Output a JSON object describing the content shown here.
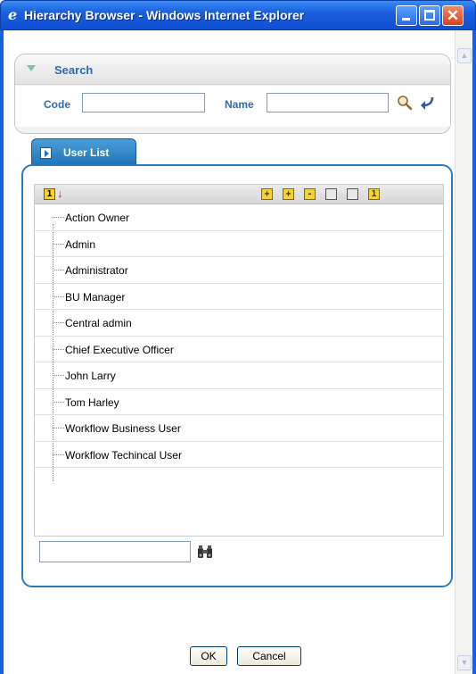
{
  "window": {
    "title": "Hierarchy Browser - Windows Internet Explorer",
    "title_color": "#ffffff",
    "titlebar_color": "#1a5fe0",
    "buttons": {
      "minimize": "minimize-icon",
      "maximize": "maximize-icon",
      "close": "✕"
    }
  },
  "search": {
    "header_label": "Search",
    "code_label": "Code",
    "code_value": "",
    "name_label": "Name",
    "name_value": "",
    "accent_color": "#2d6bb4"
  },
  "user_list": {
    "tab_label": "User List",
    "sort_glyph": "1",
    "toolbar_icons": [
      "expand-all-icon",
      "expand-node-icon",
      "collapse-node-icon",
      "list-view-icon",
      "tree-view-icon",
      "number-icon"
    ],
    "toolbar_glyphs": [
      "+",
      "+",
      "-",
      "",
      "",
      "1"
    ],
    "items": [
      "Action Owner",
      "Admin",
      "Administrator",
      "BU Manager",
      "Central admin",
      "Chief Executive Officer",
      "John Larry",
      "Tom Harley",
      "Workflow Business User",
      "Workflow Techincal User"
    ],
    "find_value": ""
  },
  "footer": {
    "ok_label": "OK",
    "cancel_label": "Cancel"
  }
}
